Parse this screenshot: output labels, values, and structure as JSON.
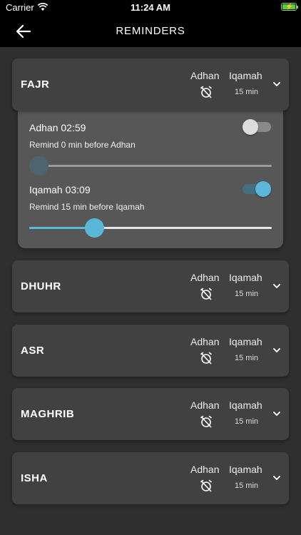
{
  "status_bar": {
    "carrier": "Carrier",
    "time": "11:24 AM"
  },
  "header": {
    "title": "REMINDERS"
  },
  "colors": {
    "accent": "#5bb7d8",
    "accent_track": "#456e80",
    "thumb_off": "#4e6570",
    "card_bg": "#414141",
    "panel_bg": "#575757"
  },
  "prayers": [
    {
      "name": "FAJR",
      "adhan_label": "Adhan",
      "iqamah_label": "Iqamah",
      "iqamah_minutes": "15 min",
      "expanded": true
    },
    {
      "name": "DHUHR",
      "adhan_label": "Adhan",
      "iqamah_label": "Iqamah",
      "iqamah_minutes": "15 min",
      "expanded": false
    },
    {
      "name": "ASR",
      "adhan_label": "Adhan",
      "iqamah_label": "Iqamah",
      "iqamah_minutes": "15 min",
      "expanded": false
    },
    {
      "name": "MAGHRIB",
      "adhan_label": "Adhan",
      "iqamah_label": "Iqamah",
      "iqamah_minutes": "15 min",
      "expanded": false
    },
    {
      "name": "ISHA",
      "adhan_label": "Adhan",
      "iqamah_label": "Iqamah",
      "iqamah_minutes": "15 min",
      "expanded": false
    }
  ],
  "fajr_detail": {
    "adhan": {
      "label": "Adhan 02:59",
      "toggle_on": false,
      "remind_text": "Remind 0 min before Adhan",
      "slider_fraction": 0.04
    },
    "iqamah": {
      "label": "Iqamah 03:09",
      "toggle_on": true,
      "remind_text": "Remind 15 min before Iqamah",
      "slider_fraction": 0.27
    }
  }
}
